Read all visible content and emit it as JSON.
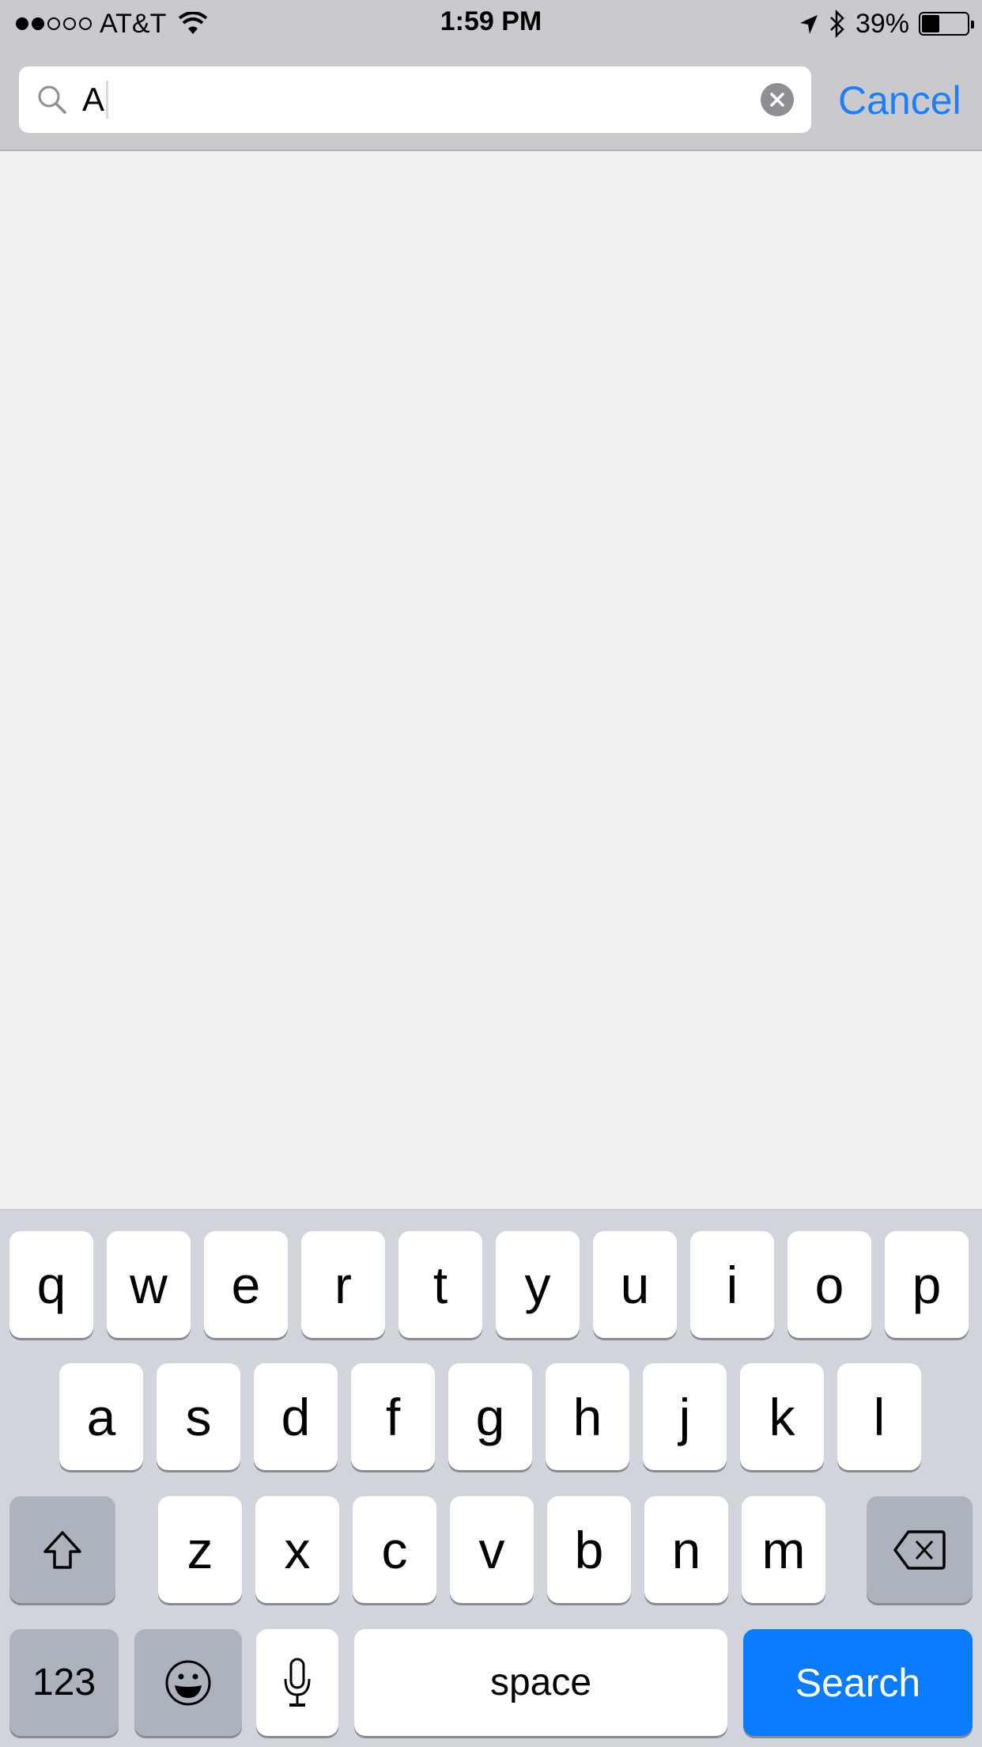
{
  "status_bar": {
    "signal_filled": 2,
    "signal_total": 5,
    "carrier": "AT&T",
    "time": "1:59 PM",
    "battery_percent_label": "39%",
    "battery_level": 0.39,
    "icons": [
      "wifi-icon",
      "location-arrow-icon",
      "bluetooth-icon",
      "battery-icon"
    ]
  },
  "search": {
    "value": "A",
    "cancel_label": "Cancel",
    "accent_color": "#1b7ff5"
  },
  "keyboard": {
    "row1": [
      "q",
      "w",
      "e",
      "r",
      "t",
      "y",
      "u",
      "i",
      "o",
      "p"
    ],
    "row2": [
      "a",
      "s",
      "d",
      "f",
      "g",
      "h",
      "j",
      "k",
      "l"
    ],
    "row3": [
      "z",
      "x",
      "c",
      "v",
      "b",
      "n",
      "m"
    ],
    "numbers_label": "123",
    "space_label": "space",
    "return_label": "Search",
    "return_color": "#0a7aff"
  }
}
